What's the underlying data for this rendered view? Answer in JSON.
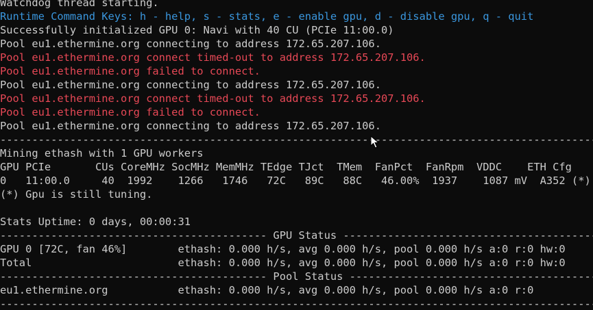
{
  "terminal": {
    "lines": [
      {
        "text": "Watchdog thread starting.",
        "color": "white"
      },
      {
        "text": "Runtime Command Keys: h - help, s - stats, e - enable gpu, d - disable gpu, q - quit",
        "color": "cyan"
      },
      {
        "text": "Successfully initialized GPU 0: Navi with 40 CU (PCIe 11:00.0)",
        "color": "white"
      },
      {
        "text": "Pool eu1.ethermine.org connecting to address 172.65.207.106.",
        "color": "white"
      },
      {
        "text": "Pool eu1.ethermine.org connect timed-out to address 172.65.207.106.",
        "color": "red"
      },
      {
        "text": "Pool eu1.ethermine.org failed to connect.",
        "color": "red"
      },
      {
        "text": "Pool eu1.ethermine.org connecting to address 172.65.207.106.",
        "color": "white"
      },
      {
        "text": "Pool eu1.ethermine.org connect timed-out to address 172.65.207.106.",
        "color": "red"
      },
      {
        "text": "Pool eu1.ethermine.org failed to connect.",
        "color": "red"
      },
      {
        "text": "Pool eu1.ethermine.org connecting to address 172.65.207.106.",
        "color": "white"
      },
      {
        "text": "--------------------------------------------------------------------------------------------------------------------",
        "color": "white"
      },
      {
        "text": "Mining ethash with 1 GPU workers",
        "color": "white"
      },
      {
        "text": "GPU PCIe       CUs CoreMHz SocMHz MemMHz TEdge TJct  TMem  FanPct  FanRpm  VDDC    ETH Cfg",
        "color": "white"
      },
      {
        "text": "0   11:00.0     40  1992    1266   1746   72C   89C   88C   46.00%  1937    1087 mV  A352 (*)",
        "color": "white"
      },
      {
        "text": "(*) Gpu is still tuning.",
        "color": "white"
      },
      {
        "text": "",
        "color": "white"
      },
      {
        "text": "Stats Uptime: 0 days, 00:00:31",
        "color": "white"
      },
      {
        "text": "------------------------------------------ GPU Status -------------------------------------------------------",
        "color": "white"
      },
      {
        "text": "GPU 0 [72C, fan 46%]        ethash: 0.000 h/s, avg 0.000 h/s, pool 0.000 h/s a:0 r:0 hw:0",
        "color": "white"
      },
      {
        "text": "Total                       ethash: 0.000 h/s, avg 0.000 h/s, pool 0.000 h/s a:0 r:0 hw:0",
        "color": "white"
      },
      {
        "text": "------------------------------------------ Pool Status -----------------------------------------------------",
        "color": "white"
      },
      {
        "text": "eu1.ethermine.org           ethash: 0.000 h/s, avg 0.000 h/s, pool 0.000 h/s a:0 r:0",
        "color": "white"
      },
      {
        "text": "--------------------------------------------------------------------------------------------------------------------",
        "color": "white"
      }
    ],
    "cursor_icon": "mouse-pointer-icon"
  },
  "colors": {
    "background": "#0c0c0c",
    "white": "#cccccc",
    "cyan": "#3a96dd",
    "red": "#e74856"
  }
}
